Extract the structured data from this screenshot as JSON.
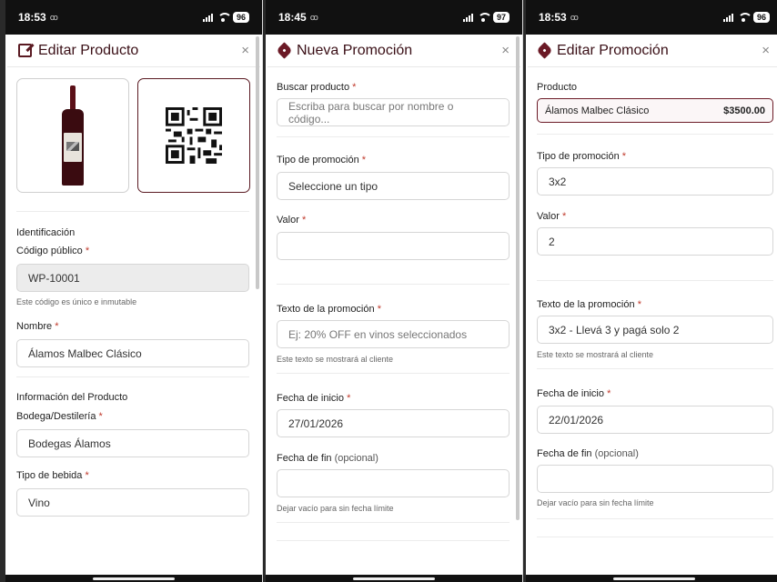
{
  "screens": [
    {
      "status": {
        "time": "18:53",
        "rec": "ꝏ",
        "battery": "96"
      },
      "title": "Editar Producto",
      "close": "×",
      "section_identificacion": "Identificación",
      "codigo_label": "Código público",
      "codigo_value": "WP-10001",
      "codigo_help": "Este código es único e inmutable",
      "nombre_label": "Nombre",
      "nombre_value": "Álamos Malbec Clásico",
      "section_info": "Información del Producto",
      "bodega_label": "Bodega/Destilería",
      "bodega_value": "Bodegas Álamos",
      "tipo_label": "Tipo de bebida",
      "tipo_value": "Vino"
    },
    {
      "status": {
        "time": "18:45",
        "rec": "ꝏ",
        "battery": "97"
      },
      "title": "Nueva Promoción",
      "close": "×",
      "buscar_label": "Buscar producto",
      "buscar_placeholder": "Escriba para buscar por nombre o código...",
      "tipo_label": "Tipo de promoción",
      "tipo_value": "Seleccione un tipo",
      "valor_label": "Valor",
      "valor_value": "",
      "texto_label": "Texto de la promoción",
      "texto_placeholder": "Ej: 20% OFF en vinos seleccionados",
      "texto_help": "Este texto se mostrará al cliente",
      "inicio_label": "Fecha de inicio",
      "inicio_value": "27/01/2026",
      "fin_label": "Fecha de fin",
      "fin_optional": "(opcional)",
      "fin_value": "",
      "fin_help": "Dejar vacío para sin fecha límite"
    },
    {
      "status": {
        "time": "18:53",
        "rec": "ꝏ",
        "battery": "96"
      },
      "title": "Editar Promoción",
      "close": "×",
      "producto_label": "Producto",
      "producto_name": "Álamos Malbec Clásico",
      "producto_price": "$3500.00",
      "tipo_label": "Tipo de promoción",
      "tipo_value": "3x2",
      "valor_label": "Valor",
      "valor_value": "2",
      "texto_label": "Texto de la promoción",
      "texto_value": "3x2 - Llevá 3 y pagá solo 2",
      "texto_help": "Este texto se mostrará al cliente",
      "inicio_label": "Fecha de inicio",
      "inicio_value": "22/01/2026",
      "fin_label": "Fecha de fin",
      "fin_optional": "(opcional)",
      "fin_value": "",
      "fin_help": "Dejar vacío para sin fecha límite"
    }
  ],
  "required_mark": "*",
  "colors": {
    "brand": "#5a1a22",
    "required": "#c0392b"
  },
  "icons": {
    "edit": "edit-icon",
    "tag": "tag-icon",
    "close": "close-icon"
  }
}
